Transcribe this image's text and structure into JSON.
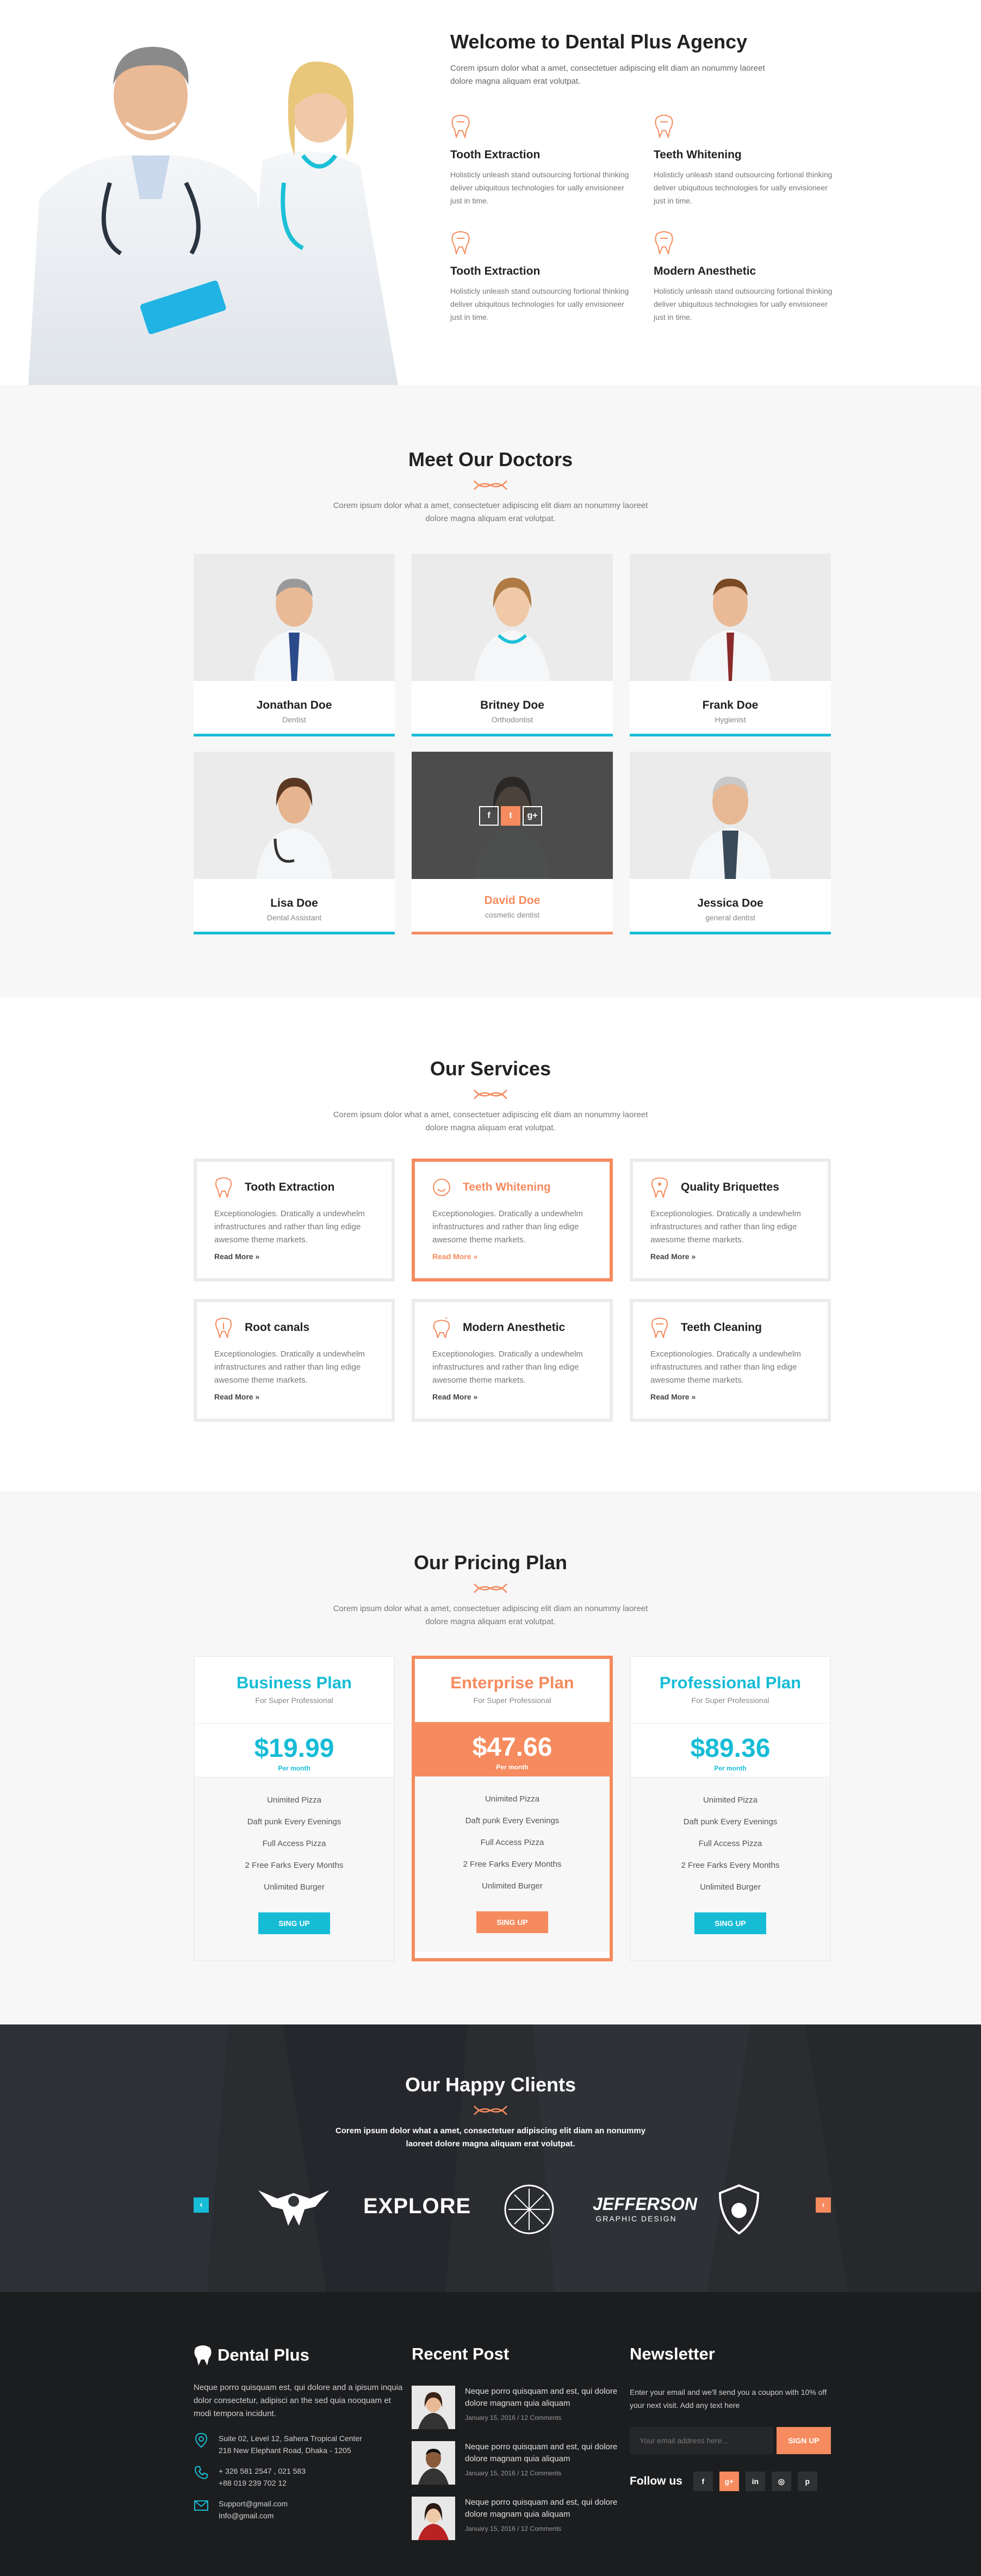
{
  "colors": {
    "accent": "#f58b5e",
    "teal": "#16bcd6"
  },
  "about": {
    "title": "Welcome to Dental Plus Agency",
    "text": "Corem ipsum dolor what a amet, consectetuer adipiscing elit diam an nonummy laoreet dolore magna aliquam erat volutpat.",
    "features": [
      {
        "icon": "tooth-icon",
        "title": "Tooth Extraction",
        "text": "Holisticly unleash stand outsourcing fortional thinking deliver ubiquitous technologies for ually envisioneer just in time."
      },
      {
        "icon": "tooth-icon",
        "title": "Teeth Whitening",
        "text": "Holisticly unleash stand outsourcing fortional thinking deliver ubiquitous technologies for ually envisioneer just in time."
      },
      {
        "icon": "tooth-icon",
        "title": "Tooth Extraction",
        "text": "Holisticly unleash stand outsourcing fortional thinking deliver ubiquitous technologies for ually envisioneer just in time."
      },
      {
        "icon": "tooth-icon",
        "title": "Modern Anesthetic",
        "text": "Holisticly unleash stand outsourcing fortional thinking deliver ubiquitous technologies for ually envisioneer just in time."
      }
    ]
  },
  "doctors": {
    "title": "Meet Our Doctors",
    "subtitle": "Corem ipsum dolor what a amet, consectetuer adipiscing elit diam an nonummy laoreet dolore magna aliquam erat volutpat.",
    "items": [
      {
        "name": "Jonathan Doe",
        "role": "Dentist"
      },
      {
        "name": "Britney Doe",
        "role": "Orthodontist"
      },
      {
        "name": "Frank Doe",
        "role": "Hygienist"
      },
      {
        "name": "Lisa Doe",
        "role": "Dental Assistant"
      },
      {
        "name": "David Doe",
        "role": "cosmetic dentist"
      },
      {
        "name": "Jessica Doe",
        "role": "general dentist"
      }
    ],
    "social": [
      "f",
      "t",
      "g+"
    ]
  },
  "services": {
    "title": "Our Services",
    "subtitle": "Corem ipsum dolor what a amet, consectetuer adipiscing elit diam an nonummy laoreet dolore magna aliquam erat volutpat.",
    "read_more": "Read More",
    "items": [
      {
        "title": "Tooth Extraction",
        "text": "Exceptionologies. Dratically a undewhelm infrastructures and rather than ling edige awesome theme markets."
      },
      {
        "title": "Teeth Whitening",
        "text": "Exceptionologies. Dratically a undewhelm infrastructures and rather than ling edige awesome theme markets."
      },
      {
        "title": "Quality Briquettes",
        "text": "Exceptionologies. Dratically a undewhelm infrastructures and rather than ling edige awesome theme markets."
      },
      {
        "title": "Root canals",
        "text": "Exceptionologies. Dratically a undewhelm infrastructures and rather than ling edige awesome theme markets."
      },
      {
        "title": "Modern Anesthetic",
        "text": "Exceptionologies. Dratically a undewhelm infrastructures and rather than ling edige awesome theme markets."
      },
      {
        "title": "Teeth Cleaning",
        "text": "Exceptionologies. Dratically a undewhelm infrastructures and rather than ling edige awesome theme markets."
      }
    ]
  },
  "pricing": {
    "title": "Our Pricing Plan",
    "subtitle": "Corem ipsum dolor what a amet, consectetuer adipiscing elit diam an nonummy laoreet dolore magna aliquam erat volutpat.",
    "plans": [
      {
        "name": "Business Plan",
        "sub": "For Super Professional",
        "price": "$19.99",
        "period": "Per month",
        "features": [
          "Unimited Pizza",
          "Daft punk Every Evenings",
          "Full Access Pizza",
          "2 Free Farks Every Months",
          "Unlimited Burger"
        ],
        "button": "SING UP"
      },
      {
        "name": "Enterprise Plan",
        "sub": "For Super Professional",
        "price": "$47.66",
        "period": "Per month",
        "features": [
          "Unimited Pizza",
          "Daft punk Every Evenings",
          "Full Access Pizza",
          "2 Free Farks Every Months",
          "Unlimited Burger"
        ],
        "button": "SING UP"
      },
      {
        "name": "Professional Plan",
        "sub": "For Super Professional",
        "price": "$89.36",
        "period": "Per month",
        "features": [
          "Unimited Pizza",
          "Daft punk Every Evenings",
          "Full Access Pizza",
          "2 Free Farks Every Months",
          "Unlimited Burger"
        ],
        "button": "SING UP"
      }
    ]
  },
  "clients": {
    "title": "Our Happy Clients",
    "subtitle": "Corem ipsum dolor what a amet, consectetuer adipiscing elit diam an nonummy laoreet dolore magna aliquam erat volutpat.",
    "prev": "‹",
    "next": "›",
    "logos": {
      "explore": "EXPLORE",
      "jefferson": "JEFFERSON",
      "jefferson_sub": "GRAPHIC DESIGN"
    }
  },
  "footer": {
    "brand": "Dental Plus",
    "about": "Neque porro quisquam est, qui dolore and a ipisum inquia dolor consectetur, adipisci an the sed quia nooquam et modi tempora incidunt.",
    "address": [
      "Suite 02, Level 12, Sahera Tropical Center",
      "218 New Elephant Road, Dhaka - 1205"
    ],
    "phones": [
      "+ 326 581 2547 , 021 583",
      "+88 019 239 702 12"
    ],
    "emails": [
      "Support@gmail.com",
      "Info@gmail.com"
    ],
    "recent_title": "Recent Post",
    "posts": [
      {
        "text": "Neque porro quisquam and est, qui dolore dolore magnam quia aliquam",
        "meta": "January 15, 2016   /   12 Comments"
      },
      {
        "text": "Neque porro quisquam and est, qui dolore dolore magnam quia aliquam",
        "meta": "January 15, 2016   /   12 Comments"
      },
      {
        "text": "Neque porro quisquam and est, qui dolore dolore magnam quia aliquam",
        "meta": "January 15, 2016   /   12 Comments"
      }
    ],
    "newsletter_title": "Newsletter",
    "newsletter_text": "Enter your email and we'll send you a coupon with 10% off your next visit. Add any text here",
    "email_placeholder": "Your email address here...",
    "signup": "SIGN UP",
    "follow": "Follow us",
    "social": [
      "f",
      "g+",
      "in",
      "◎",
      "p"
    ]
  }
}
